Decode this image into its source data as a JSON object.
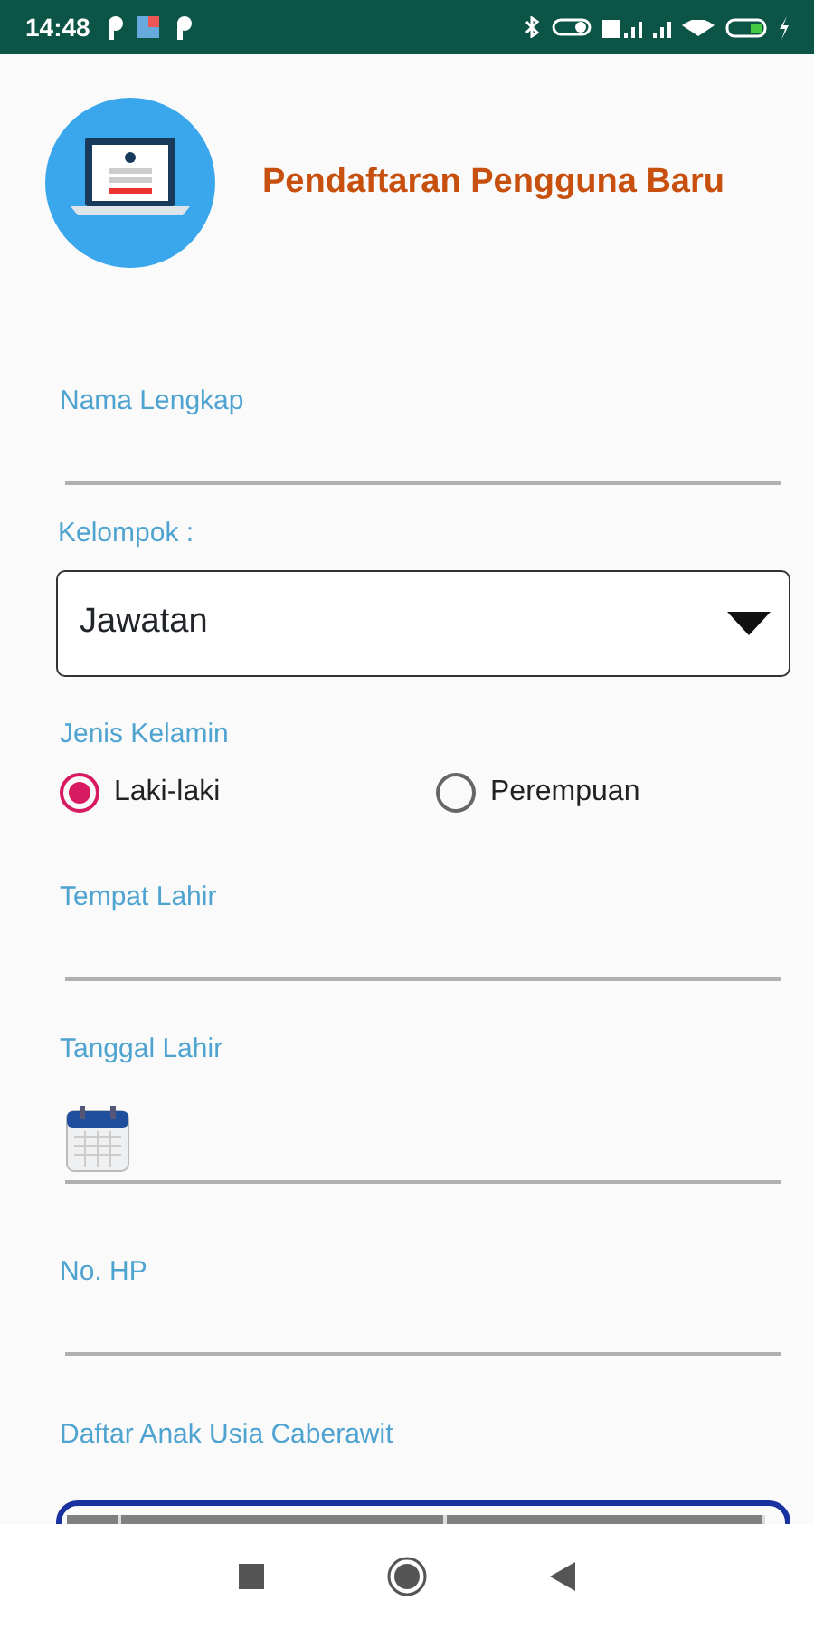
{
  "status_bar": {
    "time": "14:48"
  },
  "header": {
    "title": "Pendaftaran Pengguna Baru"
  },
  "fields": [
    {
      "kind": "text",
      "label": "Nama Lengkap"
    },
    {
      "kind": "select",
      "label": "Kelompok :",
      "value": "Jawatan"
    },
    {
      "kind": "radio",
      "label": "Jenis Kelamin",
      "options": [
        {
          "label": "Laki-laki",
          "selected": true
        },
        {
          "label": "Perempuan",
          "selected": false
        }
      ]
    },
    {
      "kind": "text",
      "label": "Tempat Lahir"
    },
    {
      "kind": "date",
      "label": "Tanggal Lahir"
    },
    {
      "kind": "text",
      "label": "No. HP"
    }
  ],
  "table": {
    "label": "Daftar Anak Usia Caberawit"
  }
}
